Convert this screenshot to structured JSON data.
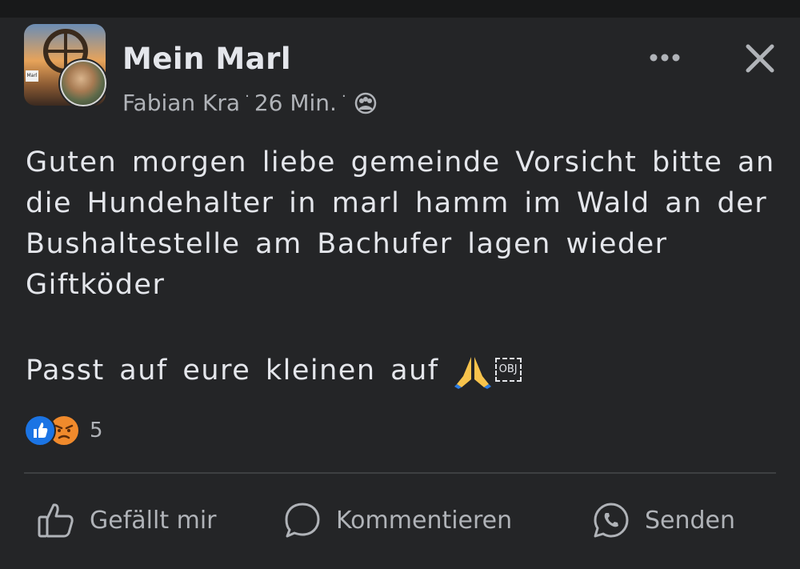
{
  "post": {
    "group_name": "Mein Marl",
    "author": "Fabian Kra",
    "dot": "·",
    "time": "26 Min.",
    "audience_icon": "group-audience-icon",
    "group_sign": "Marl",
    "body": "Guten morgen liebe gemeinde Vorsicht bitte an die Hundehalter in marl hamm im Wald an der Bushaltestelle am Bachufer lagen wieder Giftköder",
    "body2": "Passt auf eure kleinen auf",
    "emoji_icon": "folded-hands-icon",
    "obj_placeholder": "OBJ"
  },
  "reactions": {
    "icons": [
      "like-reaction-icon",
      "angry-reaction-icon"
    ],
    "count": "5",
    "colors": {
      "like": "#1b74e4",
      "angry": "#f08a2c"
    }
  },
  "actions": {
    "like_label": "Gefällt mir",
    "comment_label": "Kommentieren",
    "send_label": "Senden"
  },
  "theme": {
    "background": "#242527",
    "text": "#e4e6eb",
    "secondary_text": "#b0b3b8"
  }
}
